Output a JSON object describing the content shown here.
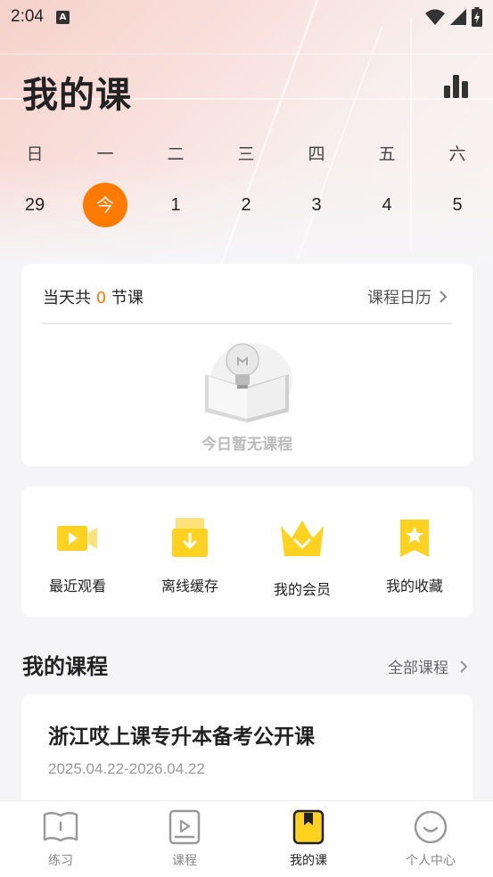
{
  "status_bar": {
    "time": "2:04",
    "notification_letter": "A"
  },
  "header": {
    "title": "我的课",
    "stats_icon": "bar-chart-icon"
  },
  "calendar": {
    "weekdays": [
      "日",
      "一",
      "二",
      "三",
      "四",
      "五",
      "六"
    ],
    "dates": [
      "29",
      "今",
      "1",
      "2",
      "3",
      "4",
      "5"
    ],
    "today_color": "#ff7a00"
  },
  "today_card": {
    "prefix": "当天共 ",
    "count": "0",
    "suffix": " 节课",
    "calendar_link": "课程日历",
    "empty_text": "今日暂无课程"
  },
  "quick_actions": [
    {
      "label": "最近观看",
      "icon": "video-camera-icon"
    },
    {
      "label": "离线缓存",
      "icon": "download-box-icon"
    },
    {
      "label": "我的会员",
      "icon": "crown-icon"
    },
    {
      "label": "我的收藏",
      "icon": "star-bookmark-icon"
    }
  ],
  "my_courses": {
    "title": "我的课程",
    "all_link": "全部课程",
    "items": [
      {
        "title": "浙江哎上课专升本备考公开课",
        "date_range": "2025.04.22-2026.04.22"
      }
    ]
  },
  "tab_bar": {
    "tabs": [
      {
        "label": "练习",
        "icon": "book-icon"
      },
      {
        "label": "课程",
        "icon": "play-card-icon"
      },
      {
        "label": "我的课",
        "icon": "my-class-icon"
      },
      {
        "label": "个人中心",
        "icon": "smile-face-icon"
      }
    ],
    "active_index": 2
  }
}
